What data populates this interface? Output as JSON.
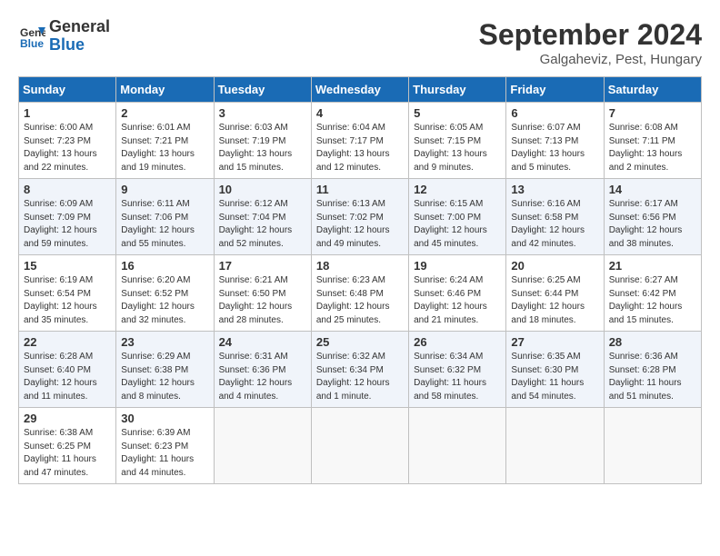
{
  "header": {
    "logo_line1": "General",
    "logo_line2": "Blue",
    "month": "September 2024",
    "location": "Galgaheviz, Pest, Hungary"
  },
  "days_of_week": [
    "Sunday",
    "Monday",
    "Tuesday",
    "Wednesday",
    "Thursday",
    "Friday",
    "Saturday"
  ],
  "weeks": [
    [
      {
        "day": "1",
        "text": "Sunrise: 6:00 AM\nSunset: 7:23 PM\nDaylight: 13 hours\nand 22 minutes."
      },
      {
        "day": "2",
        "text": "Sunrise: 6:01 AM\nSunset: 7:21 PM\nDaylight: 13 hours\nand 19 minutes."
      },
      {
        "day": "3",
        "text": "Sunrise: 6:03 AM\nSunset: 7:19 PM\nDaylight: 13 hours\nand 15 minutes."
      },
      {
        "day": "4",
        "text": "Sunrise: 6:04 AM\nSunset: 7:17 PM\nDaylight: 13 hours\nand 12 minutes."
      },
      {
        "day": "5",
        "text": "Sunrise: 6:05 AM\nSunset: 7:15 PM\nDaylight: 13 hours\nand 9 minutes."
      },
      {
        "day": "6",
        "text": "Sunrise: 6:07 AM\nSunset: 7:13 PM\nDaylight: 13 hours\nand 5 minutes."
      },
      {
        "day": "7",
        "text": "Sunrise: 6:08 AM\nSunset: 7:11 PM\nDaylight: 13 hours\nand 2 minutes."
      }
    ],
    [
      {
        "day": "8",
        "text": "Sunrise: 6:09 AM\nSunset: 7:09 PM\nDaylight: 12 hours\nand 59 minutes."
      },
      {
        "day": "9",
        "text": "Sunrise: 6:11 AM\nSunset: 7:06 PM\nDaylight: 12 hours\nand 55 minutes."
      },
      {
        "day": "10",
        "text": "Sunrise: 6:12 AM\nSunset: 7:04 PM\nDaylight: 12 hours\nand 52 minutes."
      },
      {
        "day": "11",
        "text": "Sunrise: 6:13 AM\nSunset: 7:02 PM\nDaylight: 12 hours\nand 49 minutes."
      },
      {
        "day": "12",
        "text": "Sunrise: 6:15 AM\nSunset: 7:00 PM\nDaylight: 12 hours\nand 45 minutes."
      },
      {
        "day": "13",
        "text": "Sunrise: 6:16 AM\nSunset: 6:58 PM\nDaylight: 12 hours\nand 42 minutes."
      },
      {
        "day": "14",
        "text": "Sunrise: 6:17 AM\nSunset: 6:56 PM\nDaylight: 12 hours\nand 38 minutes."
      }
    ],
    [
      {
        "day": "15",
        "text": "Sunrise: 6:19 AM\nSunset: 6:54 PM\nDaylight: 12 hours\nand 35 minutes."
      },
      {
        "day": "16",
        "text": "Sunrise: 6:20 AM\nSunset: 6:52 PM\nDaylight: 12 hours\nand 32 minutes."
      },
      {
        "day": "17",
        "text": "Sunrise: 6:21 AM\nSunset: 6:50 PM\nDaylight: 12 hours\nand 28 minutes."
      },
      {
        "day": "18",
        "text": "Sunrise: 6:23 AM\nSunset: 6:48 PM\nDaylight: 12 hours\nand 25 minutes."
      },
      {
        "day": "19",
        "text": "Sunrise: 6:24 AM\nSunset: 6:46 PM\nDaylight: 12 hours\nand 21 minutes."
      },
      {
        "day": "20",
        "text": "Sunrise: 6:25 AM\nSunset: 6:44 PM\nDaylight: 12 hours\nand 18 minutes."
      },
      {
        "day": "21",
        "text": "Sunrise: 6:27 AM\nSunset: 6:42 PM\nDaylight: 12 hours\nand 15 minutes."
      }
    ],
    [
      {
        "day": "22",
        "text": "Sunrise: 6:28 AM\nSunset: 6:40 PM\nDaylight: 12 hours\nand 11 minutes."
      },
      {
        "day": "23",
        "text": "Sunrise: 6:29 AM\nSunset: 6:38 PM\nDaylight: 12 hours\nand 8 minutes."
      },
      {
        "day": "24",
        "text": "Sunrise: 6:31 AM\nSunset: 6:36 PM\nDaylight: 12 hours\nand 4 minutes."
      },
      {
        "day": "25",
        "text": "Sunrise: 6:32 AM\nSunset: 6:34 PM\nDaylight: 12 hours\nand 1 minute."
      },
      {
        "day": "26",
        "text": "Sunrise: 6:34 AM\nSunset: 6:32 PM\nDaylight: 11 hours\nand 58 minutes."
      },
      {
        "day": "27",
        "text": "Sunrise: 6:35 AM\nSunset: 6:30 PM\nDaylight: 11 hours\nand 54 minutes."
      },
      {
        "day": "28",
        "text": "Sunrise: 6:36 AM\nSunset: 6:28 PM\nDaylight: 11 hours\nand 51 minutes."
      }
    ],
    [
      {
        "day": "29",
        "text": "Sunrise: 6:38 AM\nSunset: 6:25 PM\nDaylight: 11 hours\nand 47 minutes."
      },
      {
        "day": "30",
        "text": "Sunrise: 6:39 AM\nSunset: 6:23 PM\nDaylight: 11 hours\nand 44 minutes."
      },
      {
        "day": "",
        "text": ""
      },
      {
        "day": "",
        "text": ""
      },
      {
        "day": "",
        "text": ""
      },
      {
        "day": "",
        "text": ""
      },
      {
        "day": "",
        "text": ""
      }
    ]
  ]
}
